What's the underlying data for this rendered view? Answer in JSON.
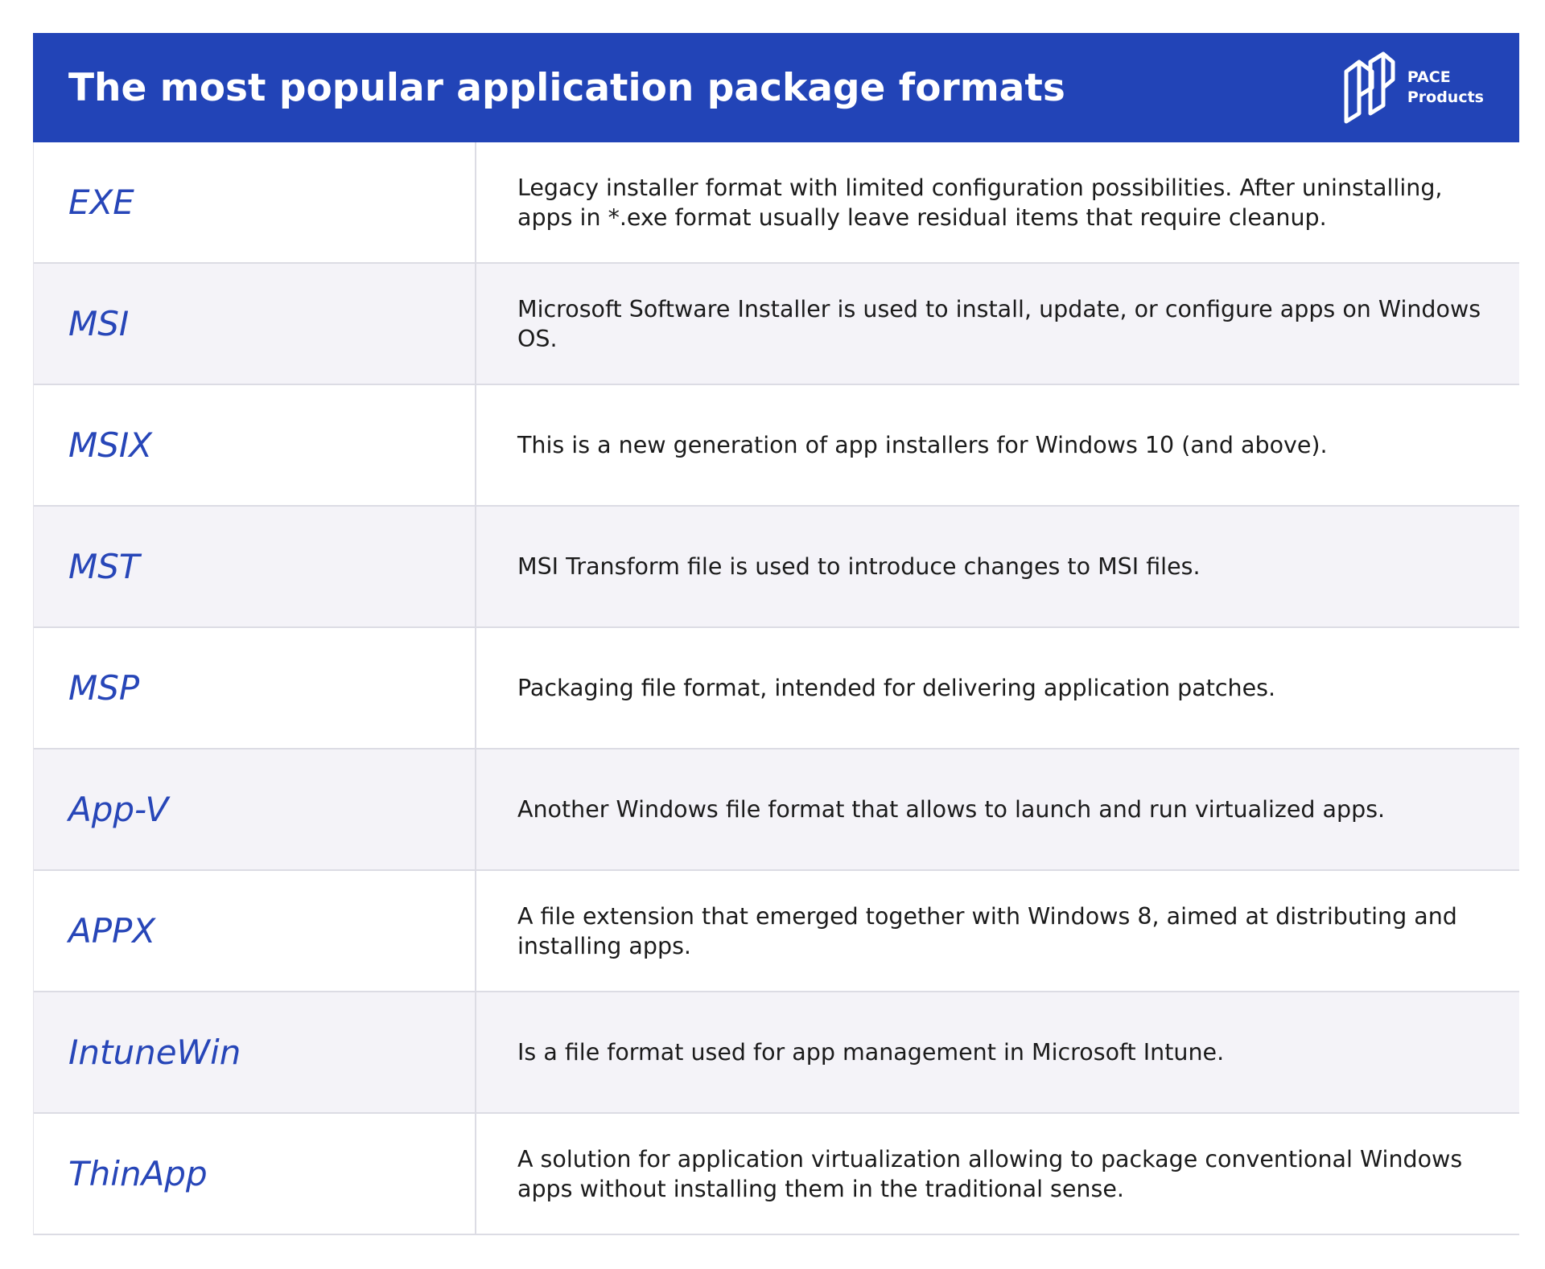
{
  "header": {
    "title": "The most popular application package formats",
    "brand_line1": "PACE",
    "brand_line2": "Products",
    "color": "#2244b7"
  },
  "colors": {
    "format_name": "#2746b8",
    "row_shade": "#f4f3f8",
    "divider": "#dcdce4"
  },
  "rows": [
    {
      "name": "EXE",
      "description": "Legacy installer format with limited configuration possibilities. After uninstalling, apps in *.exe format usually leave residual items that require cleanup."
    },
    {
      "name": "MSI",
      "description": "Microsoft Software Installer is used to install, update, or configure apps on Windows OS."
    },
    {
      "name": "MSIX",
      "description": "This is a new generation of app installers for Windows 10 (and above)."
    },
    {
      "name": "MST",
      "description": "MSI Transform file is used to introduce changes to MSI files."
    },
    {
      "name": "MSP",
      "description": "Packaging file format, intended for delivering application patches."
    },
    {
      "name": "App-V",
      "description": "Another Windows file format that allows to launch and run virtualized apps."
    },
    {
      "name": "APPX",
      "description": "A file extension that emerged together with Windows 8, aimed at distributing and installing apps."
    },
    {
      "name": "IntuneWin",
      "description": "Is a file format used for app management in Microsoft Intune."
    },
    {
      "name": "ThinApp",
      "description": "A solution for application virtualization allowing to package conventional Windows apps without installing them in the traditional sense."
    }
  ]
}
